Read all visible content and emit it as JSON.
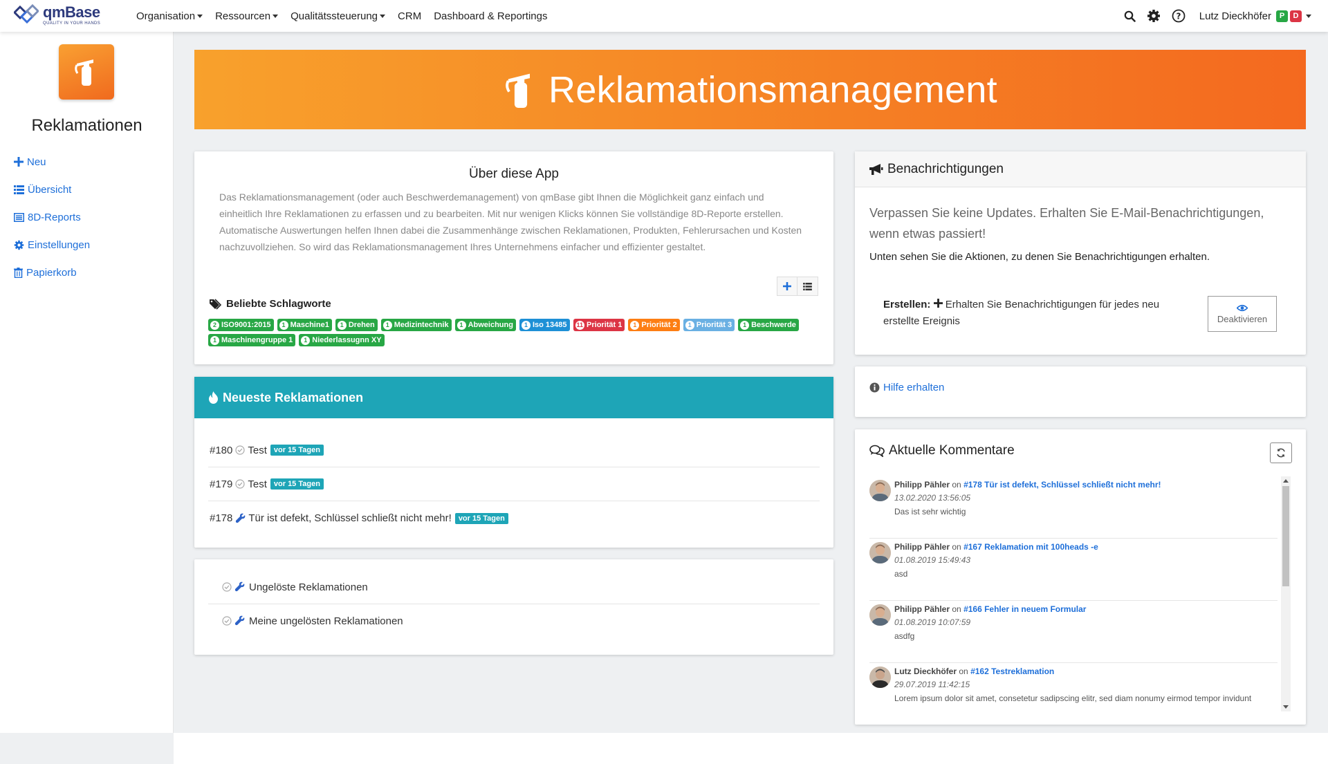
{
  "nav": {
    "logo_name": "qmBase",
    "logo_tagline": "QUALITY IN YOUR HANDS",
    "menu": [
      "Organisation",
      "Ressourcen",
      "Qualitätssteuerung",
      "CRM",
      "Dashboard & Reportings"
    ],
    "user_name": "Lutz Dieckhöfer",
    "user_badges": [
      {
        "label": "P",
        "color": "#28a745"
      },
      {
        "label": "D",
        "color": "#dc3545"
      }
    ],
    "icons": [
      "search-icon",
      "gear-icon",
      "help-icon"
    ]
  },
  "sidebar": {
    "title": "Reklamationen",
    "items": [
      {
        "label": "Neu",
        "icon": "plus-icon"
      },
      {
        "label": "Übersicht",
        "icon": "list-icon"
      },
      {
        "label": "8D-Reports",
        "icon": "table-icon"
      },
      {
        "label": "Einstellungen",
        "icon": "gear-icon"
      },
      {
        "label": "Papierkorb",
        "icon": "trash-icon"
      }
    ]
  },
  "banner": {
    "title": "Reklamationsmanagement",
    "icon": "fire-extinguisher-icon"
  },
  "about": {
    "title": "Über diese App",
    "text": "Das Reklamationsmanagement (oder auch Beschwerdemanagement) von qmBase gibt Ihnen die Möglichkeit ganz einfach und einheitlich Ihre Reklamationen zu erfassen und zu bearbeiten. Mit nur wenigen Klicks können Sie vollständige 8D-Reporte erstellen. Automatische Auswertungen helfen Ihnen dabei die Zusammenhänge zwischen Reklamationen, Produkten, Fehlerursachen und Kosten nachzuvollziehen. So wird das Reklamationsmanagement Ihres Unternehmens einfacher und effizienter gestaltet.",
    "tags_title": "Beliebte Schlagworte",
    "tags": [
      {
        "count": "2",
        "label": "ISO9001:2015",
        "color": "#28a745"
      },
      {
        "count": "1",
        "label": "Maschine1",
        "color": "#28a745"
      },
      {
        "count": "1",
        "label": "Drehen",
        "color": "#28a745"
      },
      {
        "count": "1",
        "label": "Medizintechnik",
        "color": "#28a745"
      },
      {
        "count": "1",
        "label": "Abweichung",
        "color": "#28a745"
      },
      {
        "count": "1",
        "label": "Iso 13485",
        "color": "#1e90d6"
      },
      {
        "count": "11",
        "label": "Priorität 1",
        "color": "#dc3545"
      },
      {
        "count": "1",
        "label": "Priorität 2",
        "color": "#fd7e14"
      },
      {
        "count": "1",
        "label": "Priorität 3",
        "color": "#6ab0e3"
      },
      {
        "count": "1",
        "label": "Beschwerde",
        "color": "#28a745"
      },
      {
        "count": "1",
        "label": "Maschinengruppe 1",
        "color": "#28a745"
      },
      {
        "count": "1",
        "label": "Niederlassugnn XY",
        "color": "#28a745"
      }
    ]
  },
  "recent": {
    "title": "Neueste Reklamationen",
    "items": [
      {
        "id": "#180",
        "title": "Test",
        "age": "vor 15 Tagen",
        "status_icon": "check-circle-icon"
      },
      {
        "id": "#179",
        "title": "Test",
        "age": "vor 15 Tagen",
        "status_icon": "check-circle-icon"
      },
      {
        "id": "#178",
        "title": "Tür ist defekt, Schlüssel schließt nicht mehr!",
        "age": "vor 15 Tagen",
        "status_icon": "wrench-icon"
      }
    ]
  },
  "filters": {
    "items": [
      "Ungelöste Reklamationen",
      "Meine ungelösten Reklamationen"
    ]
  },
  "notifications": {
    "title": "Benachrichtigungen",
    "lead": "Verpassen Sie keine Updates. Erhalten Sie E-Mail-Benachrichtigungen, wenn etwas passiert!",
    "sub": "Unten sehen Sie die Aktionen, zu denen Sie Benachrichtigungen erhalten.",
    "action_label": "Erstellen:",
    "action_text": "Erhalten Sie Benachrichtigungen für jedes neu erstellte Ereignis",
    "button_label": "Deaktivieren"
  },
  "help": {
    "label": "Hilfe erhalten"
  },
  "comments": {
    "title": "Aktuelle Kommentare",
    "items": [
      {
        "author": "Philipp Pähler",
        "on": "on",
        "ref": "#178 Tür ist defekt, Schlüssel schließt nicht mehr!",
        "date": "13.02.2020 13:56:05",
        "text": "Das ist sehr wichtig"
      },
      {
        "author": "Philipp Pähler",
        "on": "on",
        "ref": "#167 Reklamation mit 100heads -e",
        "date": "01.08.2019 15:49:43",
        "text": "asd"
      },
      {
        "author": "Philipp Pähler",
        "on": "on",
        "ref": "#166 Fehler in neuem Formular",
        "date": "01.08.2019 10:07:59",
        "text": "asdfg"
      },
      {
        "author": "Lutz Dieckhöfer",
        "on": "on",
        "ref": "#162 Testreklamation",
        "date": "29.07.2019 11:42:15",
        "text": "Lorem ipsum dolor sit amet, consetetur sadipscing elitr, sed diam nonumy eirmod tempor invidunt"
      }
    ]
  },
  "colors": {
    "accent": "#1e6fd9",
    "banner_start": "#f8a12c",
    "banner_end": "#f4691f",
    "teal": "#1ea5b7"
  }
}
